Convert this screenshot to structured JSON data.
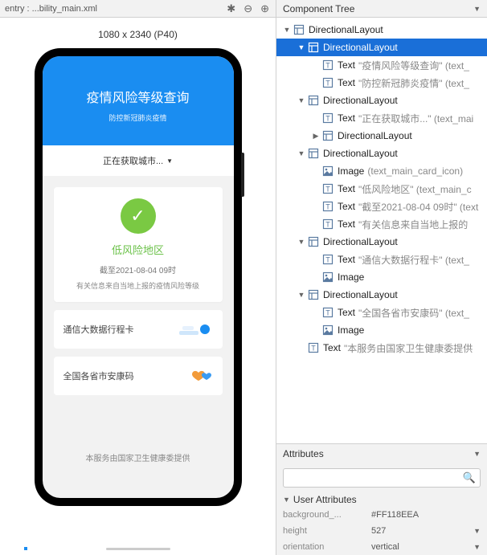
{
  "preview": {
    "tab_label": "entry : ...bility_main.xml",
    "device_label": "1080 x 2340 (P40)"
  },
  "app": {
    "title": "疫情风险等级查询",
    "subtitle": "防控新冠肺炎疫情",
    "city_loading": "正在获取城市...",
    "risk_label": "低风险地区",
    "risk_date": "截至2021-08-04 09时",
    "risk_note": "有关信息来自当地上报的疫情风险等级",
    "row1": "通信大数据行程卡",
    "row2": "全国各省市安康码",
    "footer": "本服务由国家卫生健康委提供"
  },
  "panels": {
    "tree_title": "Component Tree",
    "attr_title": "Attributes",
    "user_attrs_title": "User Attributes"
  },
  "tree": [
    {
      "depth": 0,
      "twisty": "▼",
      "icon": "layout",
      "label": "DirectionalLayout",
      "extra": "",
      "selected": false
    },
    {
      "depth": 1,
      "twisty": "▼",
      "icon": "layout",
      "label": "DirectionalLayout",
      "extra": "",
      "selected": true
    },
    {
      "depth": 2,
      "twisty": "",
      "icon": "text",
      "label": "Text",
      "extra": "\"疫情风险等级查询\" (text_",
      "selected": false
    },
    {
      "depth": 2,
      "twisty": "",
      "icon": "text",
      "label": "Text",
      "extra": "\"防控新冠肺炎疫情\" (text_",
      "selected": false
    },
    {
      "depth": 1,
      "twisty": "▼",
      "icon": "layout",
      "label": "DirectionalLayout",
      "extra": "",
      "selected": false
    },
    {
      "depth": 2,
      "twisty": "",
      "icon": "text",
      "label": "Text",
      "extra": "\"正在获取城市...\" (text_mai",
      "selected": false
    },
    {
      "depth": 2,
      "twisty": "▶",
      "icon": "layout",
      "label": "DirectionalLayout",
      "extra": "",
      "selected": false
    },
    {
      "depth": 1,
      "twisty": "▼",
      "icon": "layout",
      "label": "DirectionalLayout",
      "extra": "",
      "selected": false
    },
    {
      "depth": 2,
      "twisty": "",
      "icon": "image",
      "label": "Image",
      "extra": "(text_main_card_icon)",
      "selected": false
    },
    {
      "depth": 2,
      "twisty": "",
      "icon": "text",
      "label": "Text",
      "extra": "\"低风险地区\" (text_main_c",
      "selected": false
    },
    {
      "depth": 2,
      "twisty": "",
      "icon": "text",
      "label": "Text",
      "extra": "\"截至2021-08-04 09时\" (text",
      "selected": false
    },
    {
      "depth": 2,
      "twisty": "",
      "icon": "text",
      "label": "Text",
      "extra": "\"有关信息来自当地上报的",
      "selected": false
    },
    {
      "depth": 1,
      "twisty": "▼",
      "icon": "layout",
      "label": "DirectionalLayout",
      "extra": "",
      "selected": false
    },
    {
      "depth": 2,
      "twisty": "",
      "icon": "text",
      "label": "Text",
      "extra": "\"通信大数据行程卡\" (text_",
      "selected": false
    },
    {
      "depth": 2,
      "twisty": "",
      "icon": "image",
      "label": "Image",
      "extra": "",
      "selected": false
    },
    {
      "depth": 1,
      "twisty": "▼",
      "icon": "layout",
      "label": "DirectionalLayout",
      "extra": "",
      "selected": false
    },
    {
      "depth": 2,
      "twisty": "",
      "icon": "text",
      "label": "Text",
      "extra": "\"全国各省市安康码\" (text_",
      "selected": false
    },
    {
      "depth": 2,
      "twisty": "",
      "icon": "image",
      "label": "Image",
      "extra": "",
      "selected": false
    },
    {
      "depth": 1,
      "twisty": "",
      "icon": "text",
      "label": "Text",
      "extra": "\"本服务由国家卫生健康委提供",
      "selected": false
    }
  ],
  "attrs": {
    "search_placeholder": "",
    "rows": [
      {
        "key": "background_...",
        "val": "#FF118EEA",
        "chev": false
      },
      {
        "key": "height",
        "val": "527",
        "chev": true
      },
      {
        "key": "orientation",
        "val": "vertical",
        "chev": true
      }
    ]
  },
  "icons": {
    "layout_svg": "layout",
    "text_svg": "text",
    "image_svg": "image"
  }
}
